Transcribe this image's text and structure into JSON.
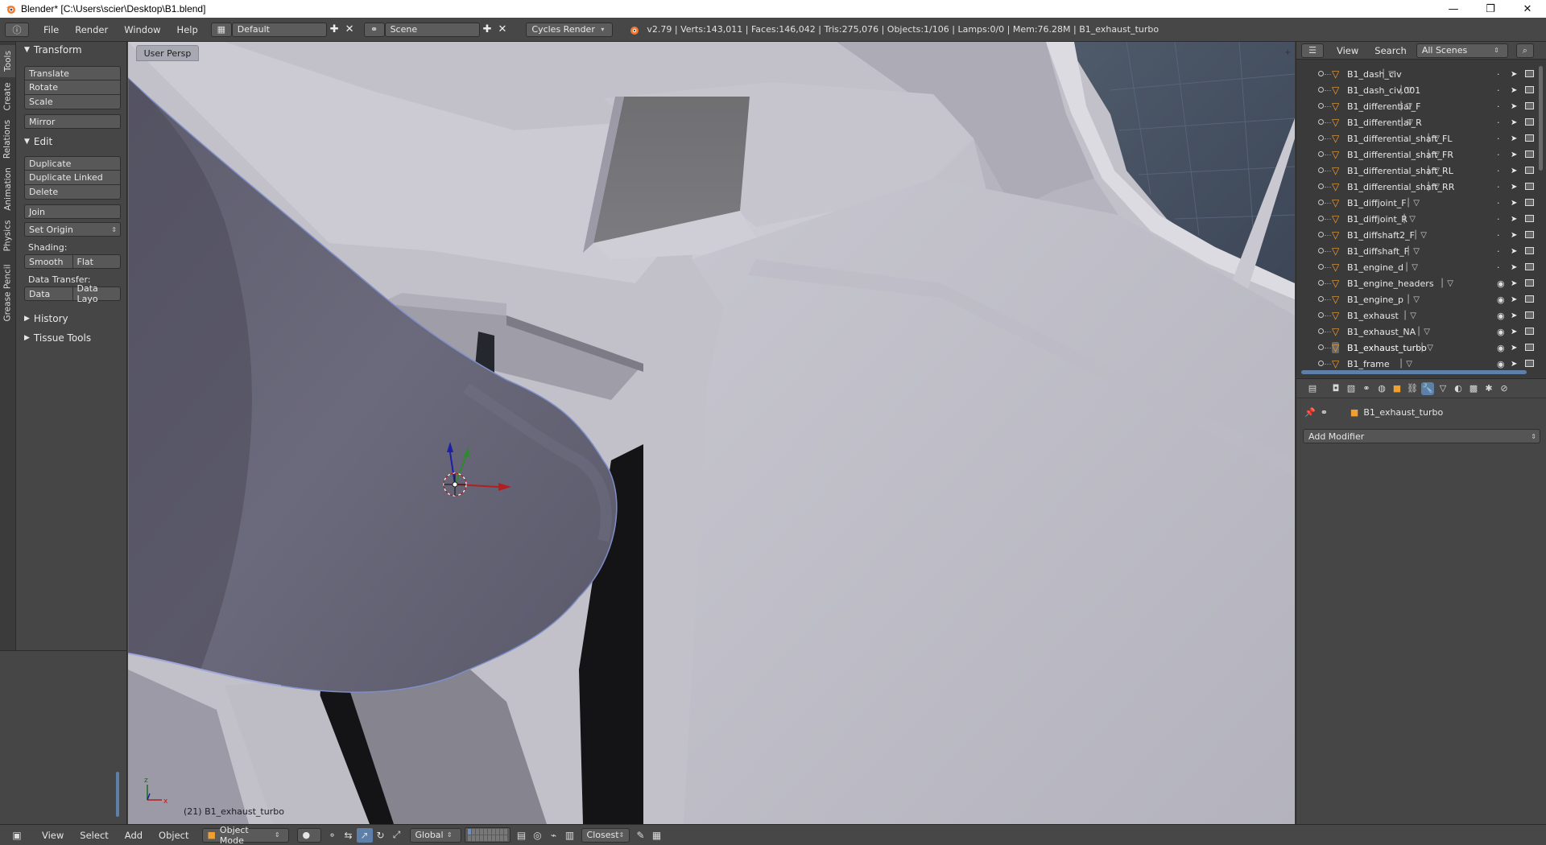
{
  "window": {
    "title": "Blender* [C:\\Users\\scier\\Desktop\\B1.blend]",
    "minimize": "—",
    "restore": "❐",
    "close": "✕"
  },
  "info_header": {
    "menus": [
      "File",
      "Render",
      "Window",
      "Help"
    ],
    "screen_layout": "Default",
    "scene": "Scene",
    "render_engine": "Cycles Render",
    "stats": "v2.79 | Verts:143,011 | Faces:146,042 | Tris:275,076 | Objects:1/106 | Lamps:0/0 | Mem:76.28M | B1_exhaust_turbo"
  },
  "tool_tabs": [
    "Tools",
    "Create",
    "Relations",
    "Animation",
    "Physics",
    "Grease Pencil"
  ],
  "tool_shelf": {
    "transform_title": "Transform",
    "translate": "Translate",
    "rotate": "Rotate",
    "scale": "Scale",
    "mirror": "Mirror",
    "edit_title": "Edit",
    "duplicate": "Duplicate",
    "duplicate_linked": "Duplicate Linked",
    "delete": "Delete",
    "join": "Join",
    "set_origin": "Set Origin",
    "shading_label": "Shading:",
    "smooth": "Smooth",
    "flat": "Flat",
    "data_transfer_label": "Data Transfer:",
    "data": "Data",
    "data_layout": "Data Layo",
    "history_title": "History",
    "tissue_tools_title": "Tissue Tools"
  },
  "viewport": {
    "view_name": "User Persp",
    "object_info": "(21) B1_exhaust_turbo"
  },
  "footer": {
    "menus": [
      "View",
      "Select",
      "Add",
      "Object"
    ],
    "mode": "Object Mode",
    "orientation": "Global",
    "snap_target": "Closest"
  },
  "outliner": {
    "menus": [
      "View",
      "Search"
    ],
    "display_mode": "All Scenes",
    "items": [
      {
        "name": "B1_dash_civ",
        "visible": false
      },
      {
        "name": "B1_dash_civ.001",
        "visible": false
      },
      {
        "name": "B1_differential_F",
        "visible": false
      },
      {
        "name": "B1_differential_R",
        "visible": false
      },
      {
        "name": "B1_differential_shaft_FL",
        "visible": false
      },
      {
        "name": "B1_differential_shaft_FR",
        "visible": false
      },
      {
        "name": "B1_differential_shaft_RL",
        "visible": false
      },
      {
        "name": "B1_differential_shaft_RR",
        "visible": false
      },
      {
        "name": "B1_diffjoint_F",
        "visible": false
      },
      {
        "name": "B1_diffjoint_R",
        "visible": false
      },
      {
        "name": "B1_diffshaft2_F",
        "visible": false
      },
      {
        "name": "B1_diffshaft_F",
        "visible": false
      },
      {
        "name": "B1_engine_d",
        "visible": false
      },
      {
        "name": "B1_engine_headers",
        "visible": true
      },
      {
        "name": "B1_engine_p",
        "visible": true
      },
      {
        "name": "B1_exhaust",
        "visible": true
      },
      {
        "name": "B1_exhaust_NA",
        "visible": true
      },
      {
        "name": "B1_exhaust_turbo",
        "visible": true,
        "selected": true
      },
      {
        "name": "B1_frame",
        "visible": true
      }
    ]
  },
  "properties": {
    "context_object": "B1_exhaust_turbo",
    "add_modifier": "Add Modifier"
  },
  "colors": {
    "ui_bg": "#464646",
    "header_bg": "#474747",
    "viewport_bg": "#b9b8c2",
    "selection_accent": "#5d7fa8",
    "object_icon": "#f0a030"
  }
}
